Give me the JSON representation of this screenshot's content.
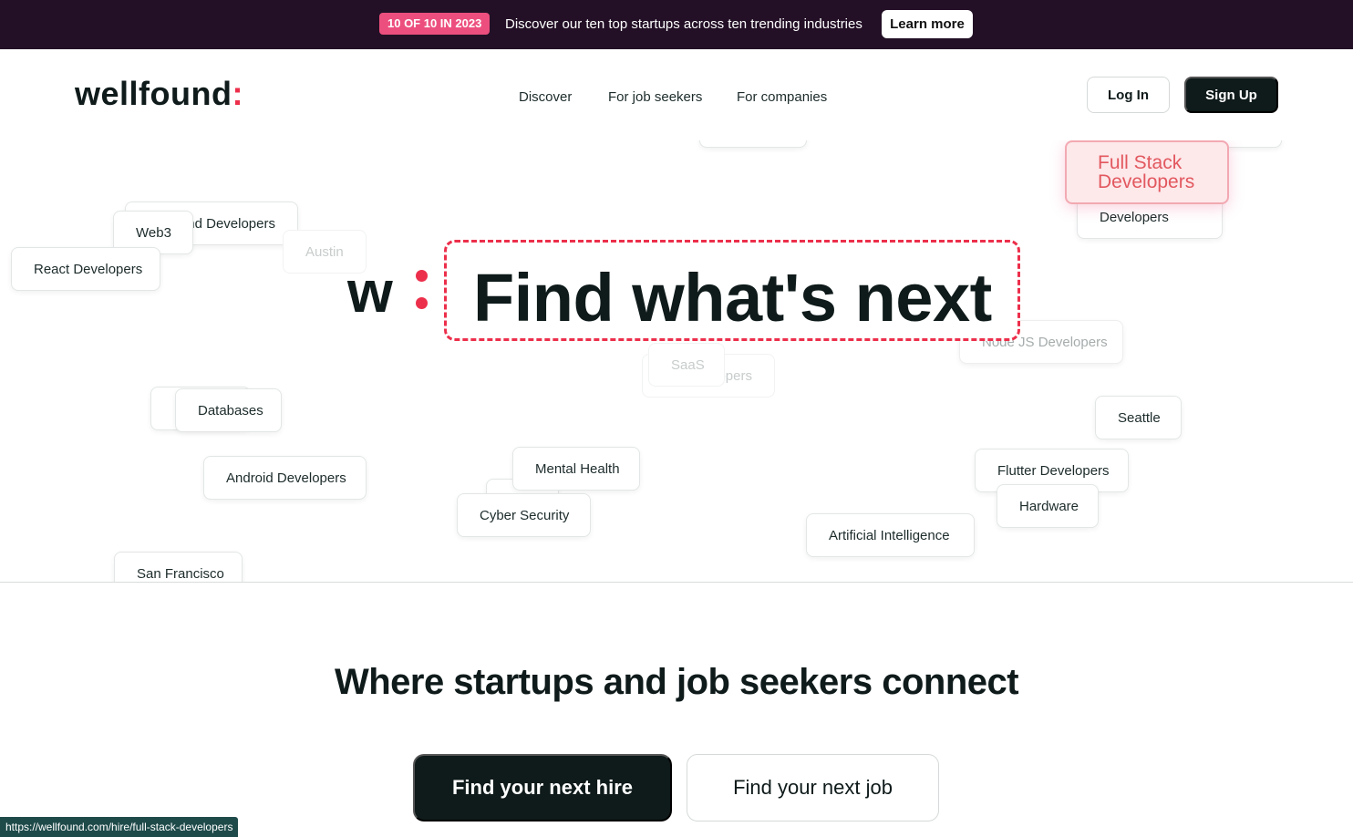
{
  "promo": {
    "badge": "10 OF 10 IN 2023",
    "text": "Discover our ten top startups across ten trending industries",
    "button": "Learn more"
  },
  "header": {
    "logo_text": "wellfound",
    "logo_colon": ":",
    "nav": [
      "Discover",
      "For job seekers",
      "For companies"
    ],
    "login": "Log In",
    "signup": "Sign Up"
  },
  "hero": {
    "mark": "w",
    "title": "Find what's next",
    "tags": {
      "web3": "Web3",
      "backend_devs": "nd Developers",
      "austin": "Austin",
      "react_devs": "React Developers",
      "full_stack": "Full Stack Developers",
      "developers": "Developers",
      "node_devs": "Node JS Developers",
      "saas": "SaaS",
      "pers": "opers",
      "databases": "Databases",
      "seattle": "Seattle",
      "android_devs": "Android Developers",
      "mental_health": "Mental Health",
      "cyber_security": "Cyber Security",
      "flutter_devs": "Flutter Developers",
      "hardware": "Hardware",
      "ai": "Artificial Intelligence",
      "san_francisco": "San Francisco"
    }
  },
  "tagline": "Where startups and job seekers connect",
  "cta": {
    "hire": "Find your next hire",
    "job": "Find your next job"
  },
  "status_url": "https://wellfound.com/hire/full-stack-developers",
  "colors": {
    "banner_bg": "#231026",
    "accent_pink": "#ec4f7e",
    "brand_red": "#ec2f4b",
    "dark": "#0f1a1a"
  }
}
